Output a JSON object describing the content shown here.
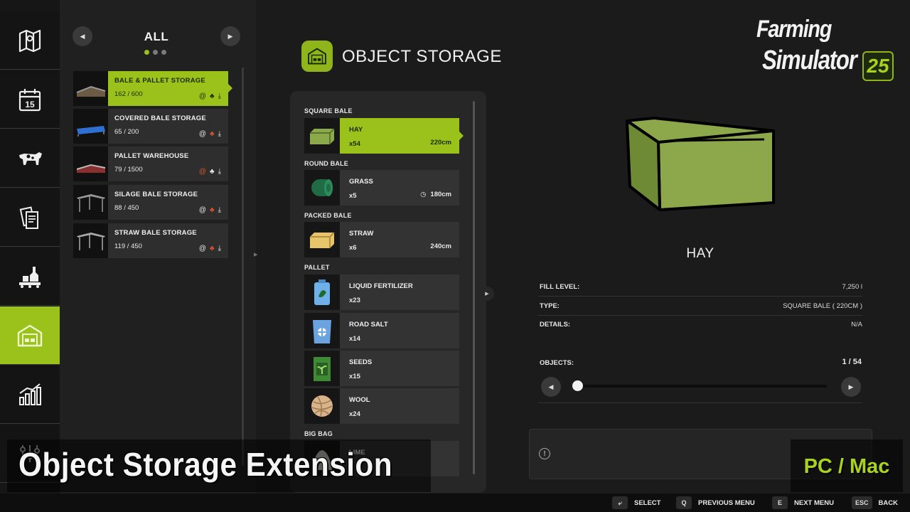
{
  "filter": {
    "title": "ALL",
    "page_count": 3,
    "active_page": 0
  },
  "sidebar": {
    "items": [
      {
        "icon": "map-icon"
      },
      {
        "icon": "calendar-icon",
        "day": "15"
      },
      {
        "icon": "animals-icon"
      },
      {
        "icon": "contracts-icon"
      },
      {
        "icon": "production-icon"
      },
      {
        "icon": "object-storage-icon",
        "active": true
      },
      {
        "icon": "statistics-icon"
      },
      {
        "icon": "settings-icon"
      }
    ]
  },
  "storages": [
    {
      "name": "BALE & PALLET STORAGE",
      "capacity": "162 / 600",
      "tags": [
        "@",
        "♣",
        "⤓"
      ],
      "active": true
    },
    {
      "name": "COVERED BALE STORAGE",
      "capacity": "65 / 200",
      "tags": [
        "@",
        "♣",
        "⤓"
      ]
    },
    {
      "name": "PALLET WAREHOUSE",
      "capacity": "79 / 1500",
      "tags": [
        "@",
        "♣",
        "⤓"
      ]
    },
    {
      "name": "SILAGE BALE STORAGE",
      "capacity": "88 / 450",
      "tags": [
        "@",
        "♣",
        "⤓"
      ]
    },
    {
      "name": "STRAW BALE STORAGE",
      "capacity": "119 / 450",
      "tags": [
        "@",
        "♣",
        "⤓"
      ]
    }
  ],
  "object_storage": {
    "title": "OBJECT STORAGE",
    "categories": [
      {
        "label": "SQUARE BALE",
        "items": [
          {
            "name": "HAY",
            "count": "x54",
            "size": "220cm",
            "active": true
          }
        ]
      },
      {
        "label": "ROUND BALE",
        "items": [
          {
            "name": "GRASS",
            "count": "x5",
            "size": "180cm",
            "fermenting": true
          }
        ]
      },
      {
        "label": "PACKED BALE",
        "items": [
          {
            "name": "STRAW",
            "count": "x6",
            "size": "240cm"
          }
        ]
      },
      {
        "label": "PALLET",
        "items": [
          {
            "name": "LIQUID FERTILIZER",
            "count": "x23"
          },
          {
            "name": "ROAD SALT",
            "count": "x14"
          },
          {
            "name": "SEEDS",
            "count": "x15"
          },
          {
            "name": "WOOL",
            "count": "x24"
          }
        ]
      },
      {
        "label": "BIG BAG",
        "items": [
          {
            "name": "LIME",
            "count": ""
          }
        ]
      }
    ]
  },
  "logo": {
    "line1": "Farming",
    "line2": "Simulator",
    "edition": "25"
  },
  "details": {
    "item_name": "HAY",
    "rows": [
      {
        "key": "FILL LEVEL:",
        "value": "7,250 l"
      },
      {
        "key": "TYPE:",
        "value": "SQUARE BALE  ( 220CM )"
      },
      {
        "key": "DETAILS:",
        "value": "N/A"
      }
    ],
    "objects_label": "OBJECTS:",
    "objects_value": "1 / 54",
    "slider_fraction": 0.0
  },
  "caption": "Object Storage Extension",
  "platform": "PC / Mac",
  "hints": [
    {
      "key": "⤶",
      "label": "SELECT"
    },
    {
      "key": "Q",
      "label": "PREVIOUS MENU"
    },
    {
      "key": "E",
      "label": "NEXT MENU"
    },
    {
      "key": "ESC",
      "label": "BACK"
    }
  ]
}
